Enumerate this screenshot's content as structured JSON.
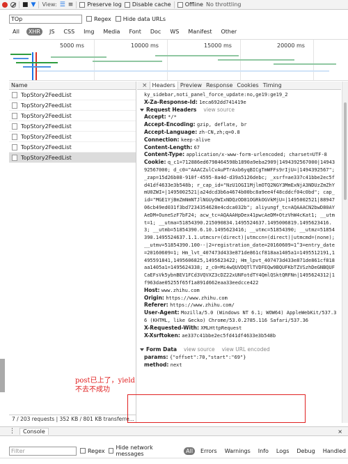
{
  "toolbar": {
    "view_label": "View:",
    "preserve_log": "Preserve log",
    "disable_cache": "Disable cache",
    "offline": "Offline",
    "throttle": "No throttling"
  },
  "filter": {
    "value": "TOp",
    "regex": "Regex",
    "hide_data_urls": "Hide data URLs"
  },
  "types": [
    "All",
    "XHR",
    "JS",
    "CSS",
    "Img",
    "Media",
    "Font",
    "Doc",
    "WS",
    "Manifest",
    "Other"
  ],
  "timeline": {
    "ticks": [
      "5000 ms",
      "10000 ms",
      "15000 ms",
      "20000 ms"
    ]
  },
  "list": {
    "header": "Name",
    "collapse": "×",
    "items": [
      "TopStory2FeedList",
      "TopStory2FeedList",
      "TopStory2FeedList",
      "TopStory2FeedList",
      "TopStory2FeedList",
      "TopStory2FeedList",
      "TopStory2FeedList"
    ],
    "status": "7 / 203 requests  |  352 KB / 801 KB transferre..."
  },
  "detail": {
    "close": "×",
    "tabs": [
      "Headers",
      "Preview",
      "Response",
      "Cookies",
      "Timing"
    ],
    "top_lines": [
      "ky_sidebar,noti_panel_force_update:no,ge19:ge19_2"
    ],
    "za_response_id_key": "X-Za-Response-Id:",
    "za_response_id_val": "1eca692dd741419e",
    "request_headers_title": "Request Headers",
    "view_source": "view source",
    "headers": [
      {
        "k": "Accept:",
        "v": "*/*"
      },
      {
        "k": "Accept-Encoding:",
        "v": "gzip, deflate, br"
      },
      {
        "k": "Accept-Language:",
        "v": "zh-CN,zh;q=0.8"
      },
      {
        "k": "Connection:",
        "v": "keep-alive"
      },
      {
        "k": "Content-Length:",
        "v": "67"
      },
      {
        "k": "Content-Type:",
        "v": "application/x-www-form-urlencoded; charset=UTF-8"
      },
      {
        "k": "Cookie:",
        "v": "q_c1=712886ed6798464598b1890a9eba2909|1494392567000|1494392567000; d_c0=\"AAACZulCvAuPTrAxb6yqBICgTmWFFs9rIjU=|1494392567\"; _zap=15d26b08-910f-4595-8a4d-d39a5126debc; _xsrf=ae337c41bbe2ec5fd41df4633e3b548b; r_cap_id=\"NzU1OGI1MjlmOTQ2NGY3MmExNjA3NDUzZmZhYmU0ZWI=|1495002521|a24dcd3b6a4674b00bc8a9ee4f48cddcf04c0bd\"; cap_id=\"MGE1YjBmZmNmNTJlNGUyOWIxNDQzOD81OGRkOGVkMjU=|1495002521|8894706cb49ed031f3bd7234354628e4cdca032b\"; aliyungf_tc=AQAAACN2bwD80AYAeDM+OuneSzF7bF24; acw_tc=AQAAAHpDex41pwcAeDM+OtzVhW4cKat1; __utmt=1; __utma=51854390.215090834.1495524637.1495006819.1495623416.3; __utmb=51854390.6.10.1495623416; __utmc=51854390; __utmz=51854390.1495524637.1.1.utmcsr=(direct)|utmccn=(direct)|utmcmd=(none); __utmv=51854390.100--|2=registration_date=20160609=1^3=entry_date=20160609=1; Hm_lvt_407473d433e871de861cf818aa1405a1=1495512191,1495591841,1495606825,1495623422; Hm_lpvt_407473d433e871de861cf818aa1405a1=1495624338; z_c0=Mi4wQUVDQTlTVDFEQw9BQUFKbTZVSzhDeGNBQUFCaEFsVk5ybnBEV1FCd3VQVXZ3cDZ22xUNFotdTY4QmlQSktQRFNn|1495624312|1f963dae05255f65f1a891d662eaa33eedcce422"
      },
      {
        "k": "Host:",
        "v": "www.zhihu.com"
      },
      {
        "k": "Origin:",
        "v": "https://www.zhihu.com"
      },
      {
        "k": "Referer:",
        "v": "https://www.zhihu.com/"
      },
      {
        "k": "User-Agent:",
        "v": "Mozilla/5.0 (Windows NT 6.1; WOW64) AppleWebKit/537.36 (KHTML, like Gecko) Chrome/53.0.2785.116 Safari/537.36"
      },
      {
        "k": "X-Requested-With:",
        "v": "XMLHttpRequest"
      },
      {
        "k": "X-Xsrftoken:",
        "v": "ae337c41bbe2ec5fd41df4633e3b548b"
      }
    ],
    "form_data_title": "Form Data",
    "view_url_encoded": "view URL encoded",
    "params_key": "params:",
    "params_val": "{\"offset\":70,\"start\":\"69\"}",
    "method_key": "method:",
    "method_val": "next"
  },
  "annotation": "post已上了，yield不去不成功",
  "drawer": {
    "console_tab": "Console"
  },
  "console_filter": {
    "placeholder": "Filter",
    "regex": "Regex",
    "hide_network": "Hide network messages",
    "levels": [
      "All",
      "Errors",
      "Warnings",
      "Info",
      "Logs",
      "Debug",
      "Handled"
    ]
  },
  "colors": {
    "accent": "#1a73e8",
    "record": "#d93025",
    "annotation": "#e02020"
  }
}
